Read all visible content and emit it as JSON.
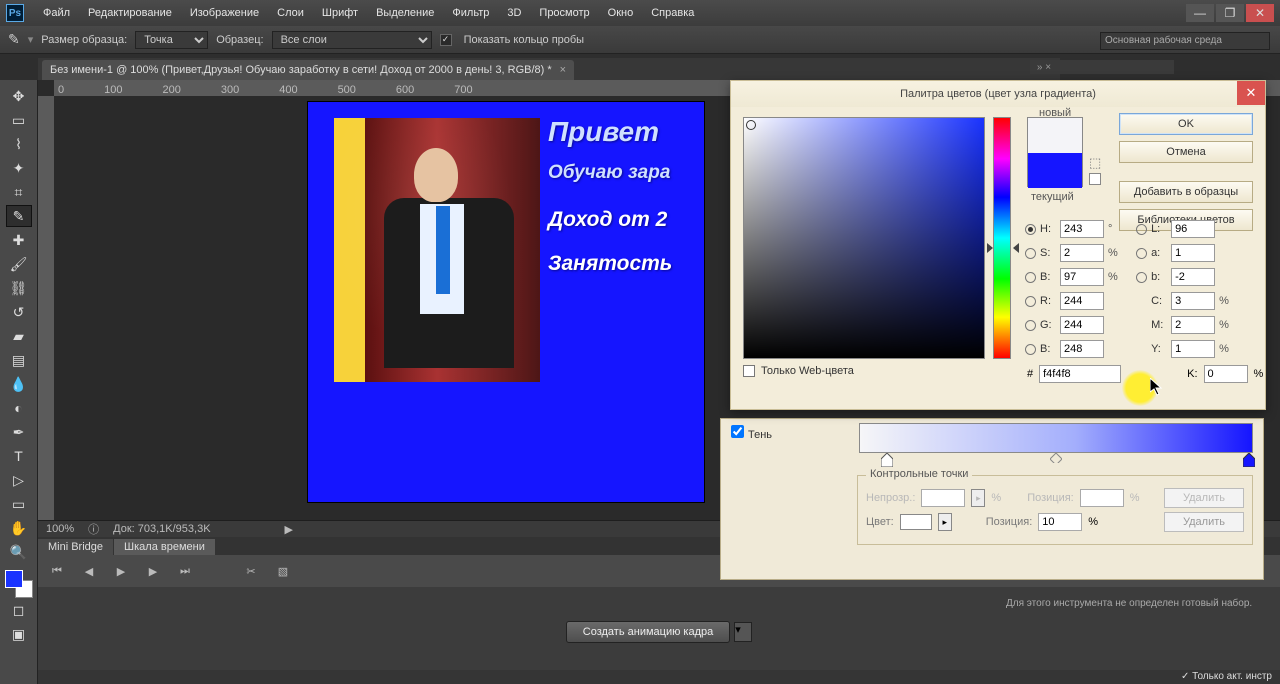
{
  "menu": {
    "items": [
      "Файл",
      "Редактирование",
      "Изображение",
      "Слои",
      "Шрифт",
      "Выделение",
      "Фильтр",
      "3D",
      "Просмотр",
      "Окно",
      "Справка"
    ]
  },
  "optionsbar": {
    "sample_size_label": "Размер образца:",
    "sample_size_value": "Точка",
    "sample_label": "Образец:",
    "sample_value": "Все слои",
    "ring_label": "Показать кольцо пробы"
  },
  "workspace_selector": "Основная рабочая среда",
  "doc_tab": {
    "title": "Без имени-1 @ 100% (Привет,Друзья! Обучаю заработку в сети! Доход от 2000 в день! 3, RGB/8) *"
  },
  "ruler_marks": [
    "0",
    "100",
    "200",
    "300",
    "400",
    "500",
    "600",
    "700"
  ],
  "canvas_text": {
    "t1": "Привет",
    "t2": "Обучаю зара",
    "t3": "Доход от 2",
    "t4": "Занятость"
  },
  "status": {
    "zoom": "100%",
    "doc": "Док: 703,1K/953,3K"
  },
  "bottom_tabs": {
    "tab1": "Mini Bridge",
    "tab2": "Шкала времени"
  },
  "anim_button": "Создать анимацию кадра",
  "right_message": "Для этого инструмента не определен готовый набор.",
  "footer_only": "Только акт. инстр",
  "gradient": {
    "shadow_label": "Тень",
    "group_title": "Контрольные точки",
    "opacity_label": "Непрозр.:",
    "position_label": "Позиция:",
    "color_label": "Цвет:",
    "position_value": "10",
    "delete_label": "Удалить",
    "percent": "%"
  },
  "picker": {
    "title": "Палитра цветов (цвет узла градиента)",
    "ok": "OK",
    "cancel": "Отмена",
    "add_swatch": "Добавить в образцы",
    "libraries": "Библиотеки цветов",
    "new_label": "новый",
    "current_label": "текущий",
    "web_only": "Только Web-цвета",
    "hex_label": "#",
    "hex_value": "f4f4f8",
    "H": {
      "l": "H:",
      "v": "243",
      "s": "°"
    },
    "S": {
      "l": "S:",
      "v": "2",
      "s": "%"
    },
    "Bb": {
      "l": "B:",
      "v": "97",
      "s": "%"
    },
    "R": {
      "l": "R:",
      "v": "244"
    },
    "G": {
      "l": "G:",
      "v": "244"
    },
    "B2": {
      "l": "B:",
      "v": "248"
    },
    "L": {
      "l": "L:",
      "v": "96"
    },
    "a": {
      "l": "a:",
      "v": "1"
    },
    "b": {
      "l": "b:",
      "v": "-2"
    },
    "C": {
      "l": "C:",
      "v": "3",
      "s": "%"
    },
    "M": {
      "l": "M:",
      "v": "2",
      "s": "%"
    },
    "Y": {
      "l": "Y:",
      "v": "1",
      "s": "%"
    },
    "K": {
      "l": "K:",
      "v": "0",
      "s": "%"
    }
  }
}
